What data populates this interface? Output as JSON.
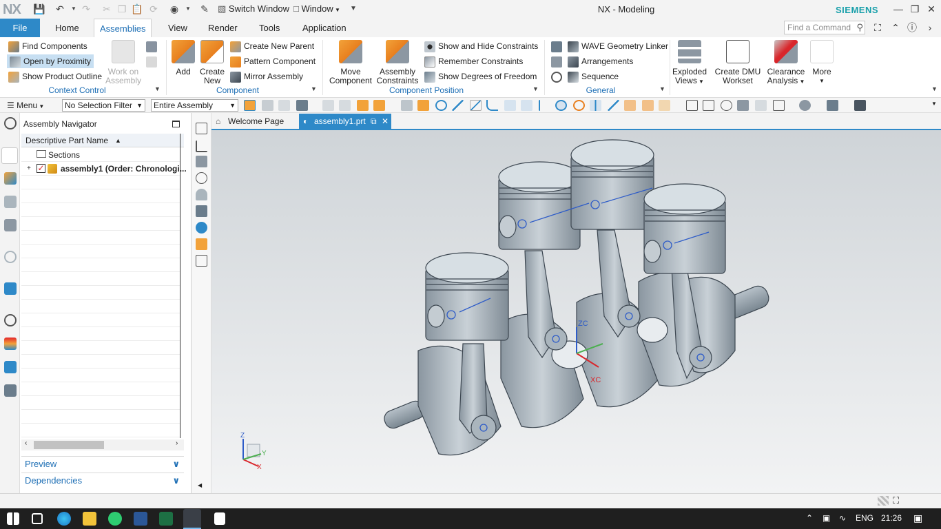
{
  "app": {
    "logo": "NX",
    "title": "NX - Modeling",
    "brand": "SIEMENS",
    "switch_window": "Switch Window",
    "window": "Window"
  },
  "menu_tabs": {
    "file": "File",
    "home": "Home",
    "assemblies": "Assemblies",
    "view": "View",
    "render": "Render",
    "tools": "Tools",
    "application": "Application"
  },
  "find_command": {
    "placeholder": "Find a Command"
  },
  "ribbon": {
    "context_control": {
      "label": "Context Control",
      "find_components": "Find Components",
      "open_by_proximity": "Open by Proximity",
      "show_product_outline": "Show Product Outline",
      "work_on_assembly_1": "Work on",
      "work_on_assembly_2": "Assembly"
    },
    "component": {
      "label": "Component",
      "add": "Add",
      "create_new_1": "Create",
      "create_new_2": "New",
      "create_new_parent": "Create New Parent",
      "pattern_component": "Pattern Component",
      "mirror_assembly": "Mirror Assembly"
    },
    "component_position": {
      "label": "Component Position",
      "move_component_1": "Move",
      "move_component_2": "Component",
      "assembly_constraints_1": "Assembly",
      "assembly_constraints_2": "Constraints",
      "show_hide_constraints": "Show and Hide Constraints",
      "remember_constraints": "Remember Constraints",
      "show_dof": "Show Degrees of Freedom"
    },
    "general": {
      "label": "General",
      "wave_linker": "WAVE Geometry Linker",
      "arrangements": "Arrangements",
      "sequence": "Sequence"
    },
    "exploded_views_1": "Exploded",
    "exploded_views_2": "Views",
    "dmu_1": "Create DMU",
    "dmu_2": "Workset",
    "clearance_1": "Clearance",
    "clearance_2": "Analysis",
    "more": "More"
  },
  "cmdbar": {
    "menu": "Menu",
    "selection_filter": "No Selection Filter",
    "scope": "Entire Assembly"
  },
  "navigator": {
    "title": "Assembly Navigator",
    "column": "Descriptive Part Name",
    "rows": [
      "Sections",
      "assembly1 (Order: Chronologi..."
    ],
    "preview": "Preview",
    "dependencies": "Dependencies"
  },
  "doc_tabs": {
    "welcome": "Welcome Page",
    "assembly": "assembly1.prt"
  },
  "viewport": {
    "axis_zc": "ZC",
    "axis_xc": "XC",
    "triad_z": "Z",
    "triad_y": "Y",
    "triad_x": "X"
  },
  "taskbar": {
    "lang": "ENG",
    "time": "21:26"
  },
  "colors": {
    "accent": "#2e89c8",
    "brand": "#179faa",
    "model_gray": "#aab5bd"
  }
}
